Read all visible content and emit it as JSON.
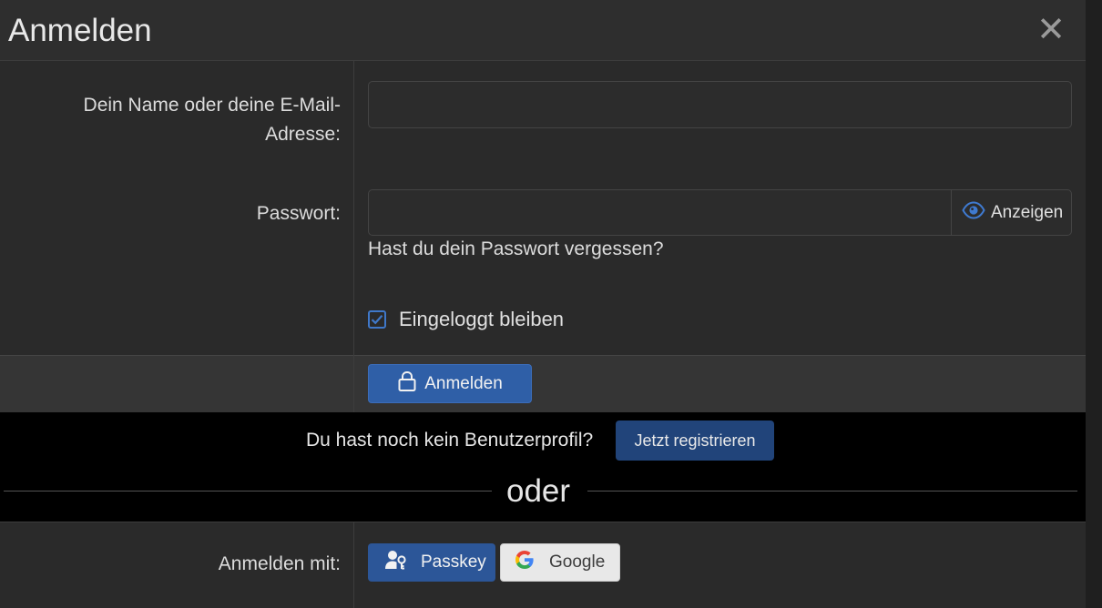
{
  "dialog": {
    "title": "Anmelden",
    "close_symbol": "✕"
  },
  "form": {
    "name_label": "Dein Name oder deine E-Mail-Adresse:",
    "name_value": "",
    "password_label": "Passwort:",
    "password_value": "",
    "show_label": "Anzeigen",
    "forgot_link": "Hast du dein Passwort vergessen?",
    "remember_label": "Eingeloggt bleiben",
    "remember_checked": true
  },
  "actions": {
    "submit_label": "Anmelden"
  },
  "register": {
    "prompt": "Du hast noch kein Benutzerprofil?",
    "button_label": "Jetzt registrieren"
  },
  "separator": {
    "text": "oder"
  },
  "social": {
    "label": "Anmelden mit:",
    "passkey_label": "Passkey",
    "google_label": "Google"
  },
  "colors": {
    "accent": "#2f5fa7",
    "register_button": "#21447a",
    "checkbox": "#3f78c9"
  },
  "icons": {
    "eye": "eye-icon",
    "lock": "lock-icon",
    "passkey": "user-key-icon",
    "google": "google-logo-icon",
    "check": "check-icon",
    "close": "close-icon"
  }
}
